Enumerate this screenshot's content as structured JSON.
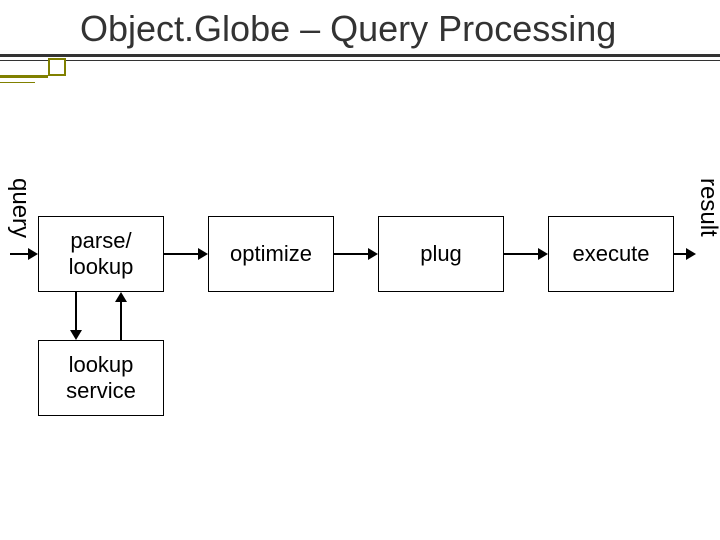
{
  "title": "Object.Globe – Query Processing",
  "labels": {
    "query": "query",
    "result": "result"
  },
  "boxes": {
    "parse_lookup": "parse/\nlookup",
    "optimize": "optimize",
    "plug": "plug",
    "execute": "execute",
    "lookup_service": "lookup\nservice"
  },
  "chart_data": {
    "type": "diagram",
    "title": "Object.Globe – Query Processing",
    "nodes": [
      {
        "id": "query_in",
        "label": "query",
        "kind": "input"
      },
      {
        "id": "parse_lookup",
        "label": "parse/ lookup",
        "kind": "process"
      },
      {
        "id": "optimize",
        "label": "optimize",
        "kind": "process"
      },
      {
        "id": "plug",
        "label": "plug",
        "kind": "process"
      },
      {
        "id": "execute",
        "label": "execute",
        "kind": "process"
      },
      {
        "id": "result_out",
        "label": "result",
        "kind": "output"
      },
      {
        "id": "lookup_service",
        "label": "lookup service",
        "kind": "service"
      }
    ],
    "edges": [
      {
        "from": "query_in",
        "to": "parse_lookup"
      },
      {
        "from": "parse_lookup",
        "to": "optimize"
      },
      {
        "from": "optimize",
        "to": "plug"
      },
      {
        "from": "plug",
        "to": "execute"
      },
      {
        "from": "execute",
        "to": "result_out"
      },
      {
        "from": "parse_lookup",
        "to": "lookup_service"
      },
      {
        "from": "lookup_service",
        "to": "parse_lookup"
      }
    ]
  }
}
